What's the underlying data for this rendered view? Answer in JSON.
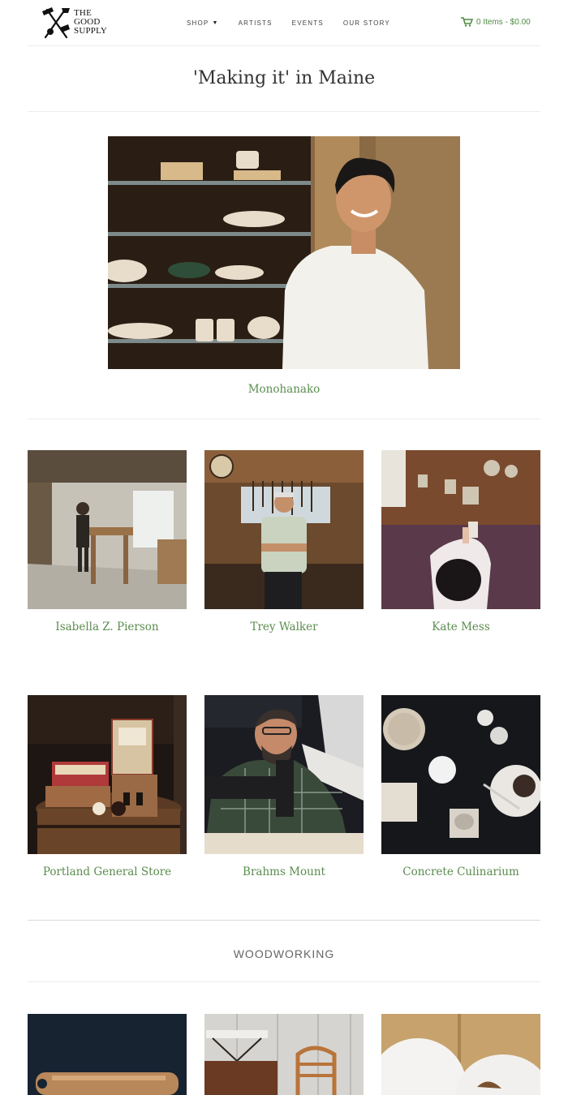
{
  "header": {
    "logo_lines": [
      "THE",
      "GOOD",
      "SUPPLY"
    ],
    "nav": [
      {
        "label": "SHOP",
        "has_dropdown": true
      },
      {
        "label": "ARTISTS"
      },
      {
        "label": "EVENTS"
      },
      {
        "label": "OUR STORY"
      }
    ],
    "cart_text": "0 Items - $0.00",
    "cart_icon": "cart-icon"
  },
  "page": {
    "title": "'Making it' in Maine"
  },
  "featured": {
    "name": "Monohanako"
  },
  "artists": [
    {
      "name": "Isabella Z. Pierson"
    },
    {
      "name": "Trey Walker"
    },
    {
      "name": "Kate Mess"
    },
    {
      "name": "Portland General Store"
    },
    {
      "name": "Brahms Mount"
    },
    {
      "name": "Concrete Culinarium"
    }
  ],
  "section": {
    "title": "WOODWORKING"
  },
  "colors": {
    "accent": "#5a8c4e",
    "text": "#333333",
    "divider": "#ececec"
  }
}
